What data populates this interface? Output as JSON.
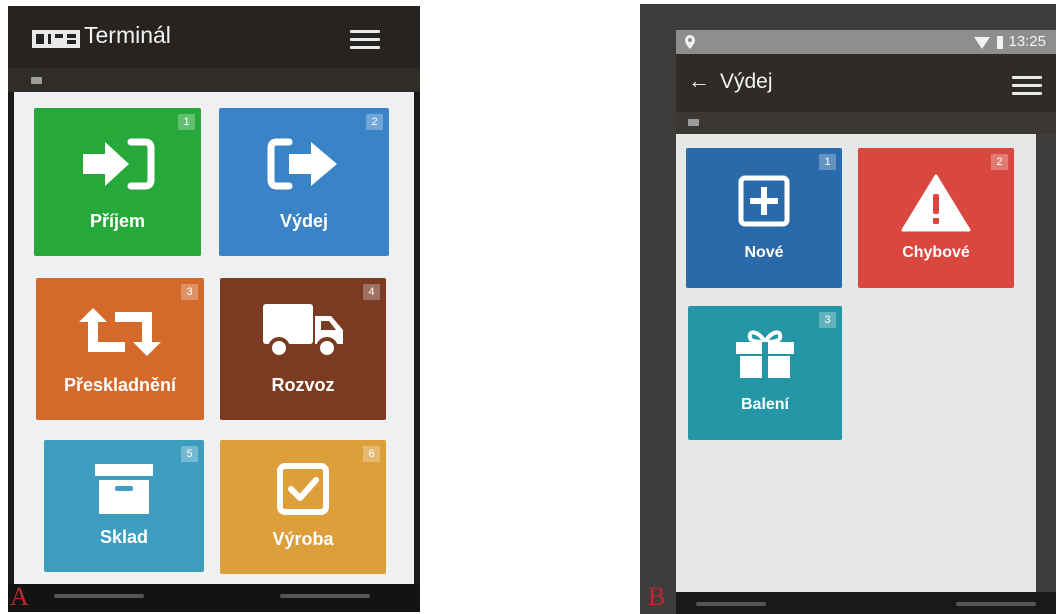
{
  "panel_a": {
    "letter": "A",
    "app_title": "Terminál",
    "tiles": [
      {
        "label": "Příjem",
        "badge": "1",
        "color": "#26a83b",
        "icon": "sign-in-icon"
      },
      {
        "label": "Výdej",
        "badge": "2",
        "color": "#3a83c6",
        "icon": "sign-out-icon"
      },
      {
        "label": "Přeskladnění",
        "badge": "3",
        "color": "#d3692a",
        "icon": "retweet-icon"
      },
      {
        "label": "Rozvoz",
        "badge": "4",
        "color": "#7b3a22",
        "icon": "truck-icon"
      },
      {
        "label": "Sklad",
        "badge": "5",
        "color": "#3d9ec0",
        "icon": "archive-icon"
      },
      {
        "label": "Výroba",
        "badge": "6",
        "color": "#dd9f3a",
        "icon": "check-square-icon"
      }
    ]
  },
  "panel_b": {
    "letter": "B",
    "status_time": "13:25",
    "screen_title": "Výdej",
    "tiles": [
      {
        "label": "Nové",
        "badge": "1",
        "color": "#2a6aaa",
        "icon": "plus-square-icon"
      },
      {
        "label": "Chybové",
        "badge": "2",
        "color": "#d9473f",
        "icon": "warning-icon"
      },
      {
        "label": "Balení",
        "badge": "3",
        "color": "#2596a6",
        "icon": "gift-icon"
      }
    ]
  }
}
